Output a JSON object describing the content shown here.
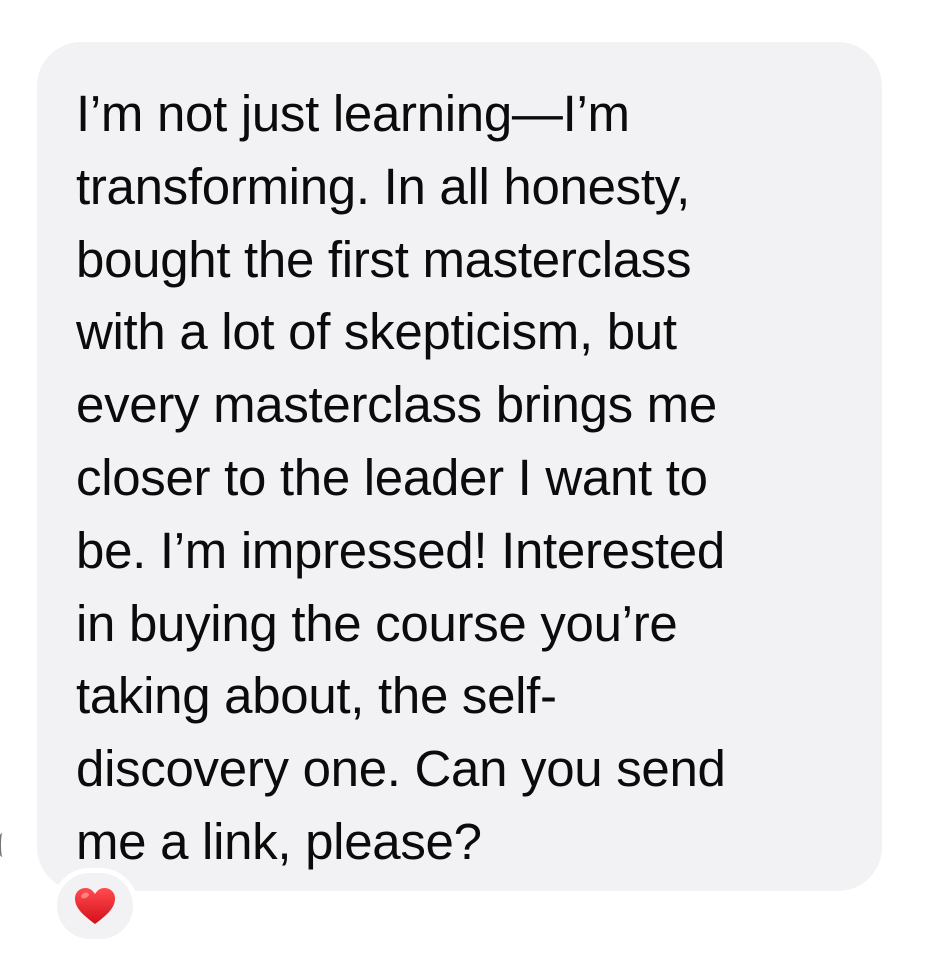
{
  "message": {
    "lines": [
      "I’m not just learning—I’m",
      "transforming. In all honesty,",
      "bought the first masterclass",
      "with a lot of skepticism, but",
      "every masterclass brings me",
      "closer to the leader I want to",
      "be. I’m impressed! Interested",
      "in buying the course you’re",
      "taking about, the self-",
      "discovery one. Can you send",
      "me a link, please?"
    ],
    "bubble_color": "#f2f2f5",
    "text_color": "#0b0b0c"
  },
  "reaction": {
    "icon": "heart-icon",
    "color": "#e0191f"
  }
}
